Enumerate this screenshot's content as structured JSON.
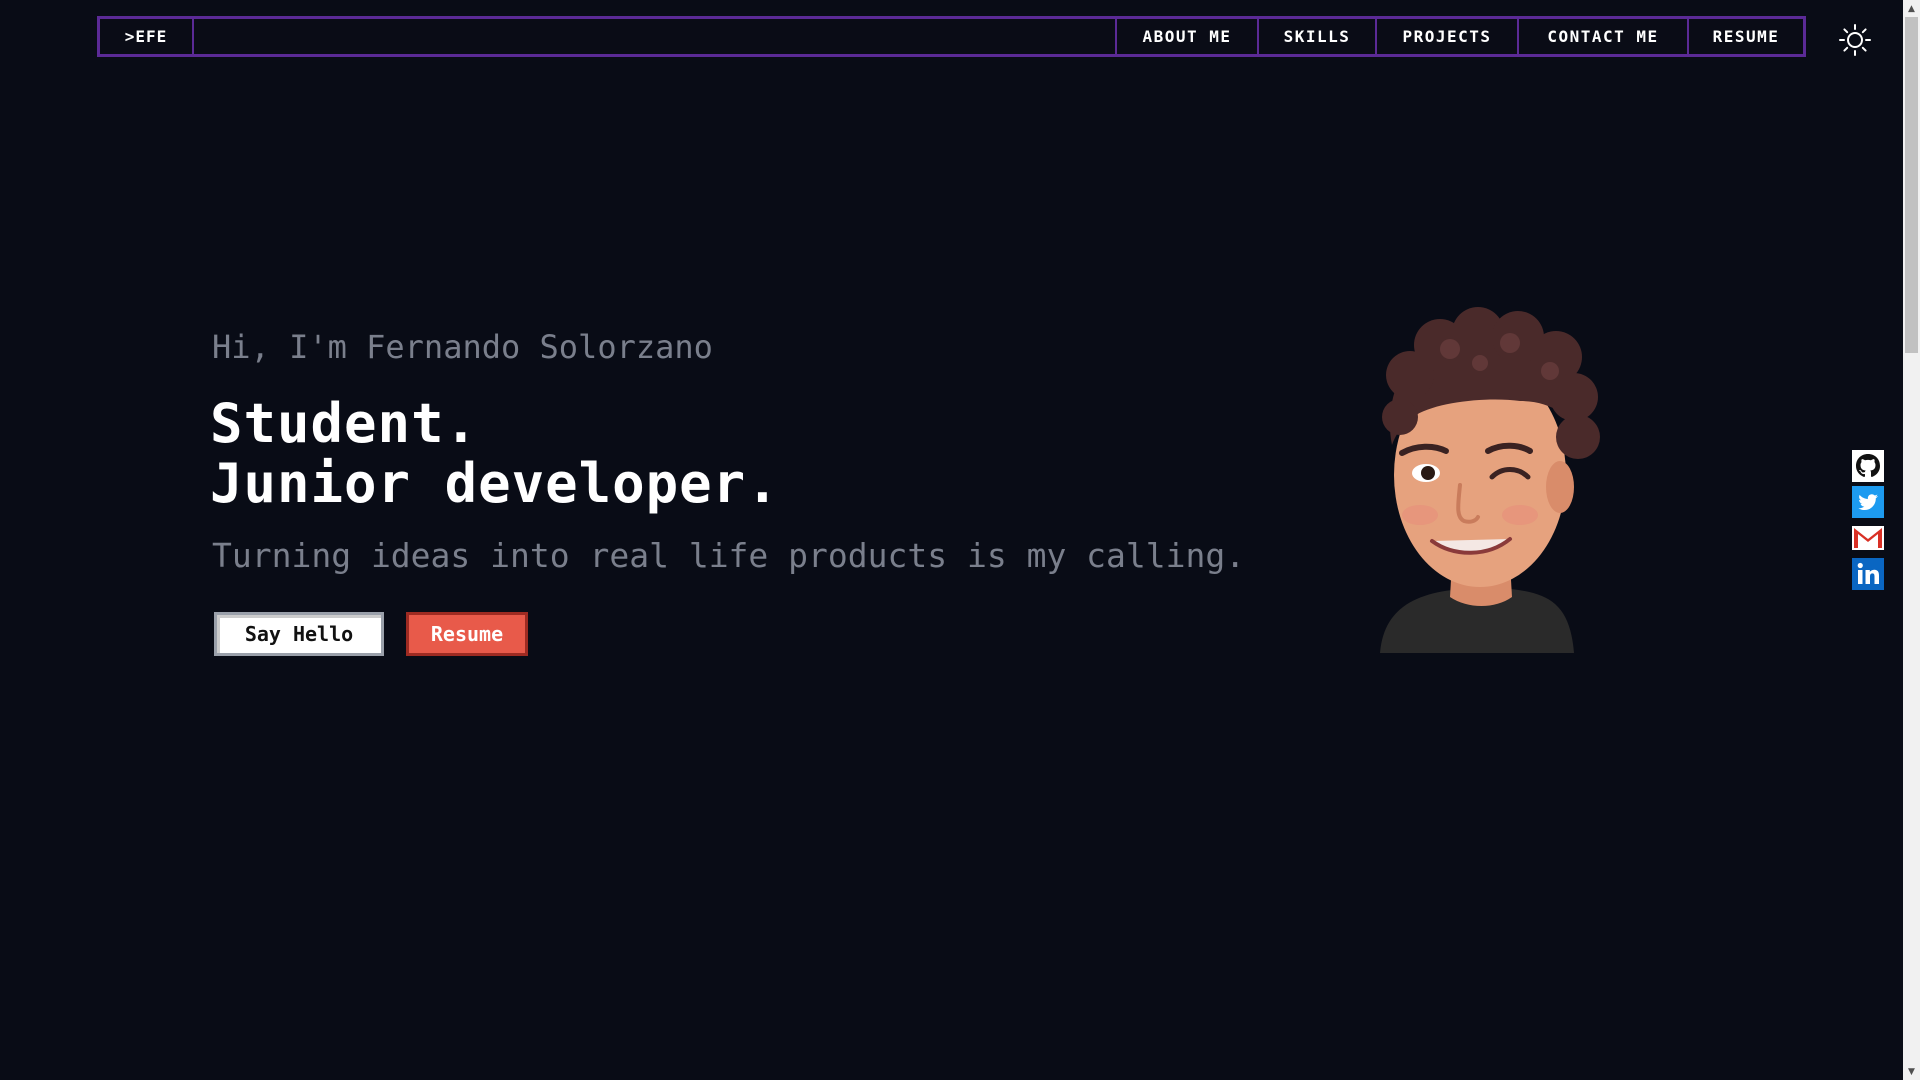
{
  "nav": {
    "brand": ">EFE",
    "links": [
      {
        "label": "ABOUT ME"
      },
      {
        "label": "SKILLS"
      },
      {
        "label": "PROJECTS"
      },
      {
        "label": "CONTACT ME"
      },
      {
        "label": "RESUME"
      }
    ],
    "theme_icon": "sun-icon"
  },
  "hero": {
    "greeting": "Hi, I'm Fernando Solorzano",
    "headline_line1": "Student.",
    "headline_line2": "Junior developer.",
    "tagline": "Turning ideas into real life products is my calling.",
    "say_hello_label": "Say Hello",
    "resume_label": "Resume",
    "avatar": "memoji-avatar-winking"
  },
  "social": [
    {
      "icon": "github-icon"
    },
    {
      "icon": "twitter-icon"
    },
    {
      "icon": "gmail-icon"
    },
    {
      "icon": "linkedin-icon"
    }
  ],
  "colors": {
    "background": "#090c16",
    "nav_border": "#5b2a96",
    "accent_red": "#e85a4a",
    "muted_text": "#7a7f8c"
  }
}
